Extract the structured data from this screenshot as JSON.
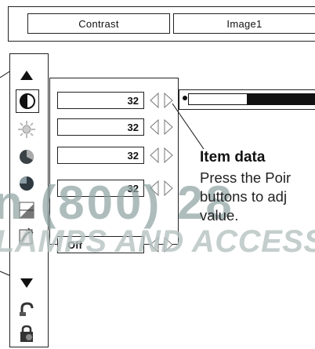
{
  "header": {
    "tab_left": "Contrast",
    "tab_right": "Image1"
  },
  "menu_icons": [
    "up-triangle-icon",
    "contrast-icon",
    "brightness-icon",
    "color-icon",
    "tint-icon",
    "sharpness-icon",
    "gamma-icon",
    "down-triangle-icon",
    "reset-icon",
    "store-icon"
  ],
  "values": [
    {
      "label": "32"
    },
    {
      "label": "32"
    },
    {
      "label": "32"
    },
    {
      "label": "32"
    },
    {
      "label": "Off"
    }
  ],
  "slider": {
    "level": 0.46
  },
  "callout": {
    "title": "Item data",
    "line1": "Press the Poir",
    "line2": "buttons to adj",
    "line3": "value."
  },
  "watermark": {
    "line1": "n (800) 28",
    "line2": "LAMPS AND ACCESS"
  },
  "colors": {
    "ink": "#111111",
    "watermark": "#8fa4a3"
  }
}
